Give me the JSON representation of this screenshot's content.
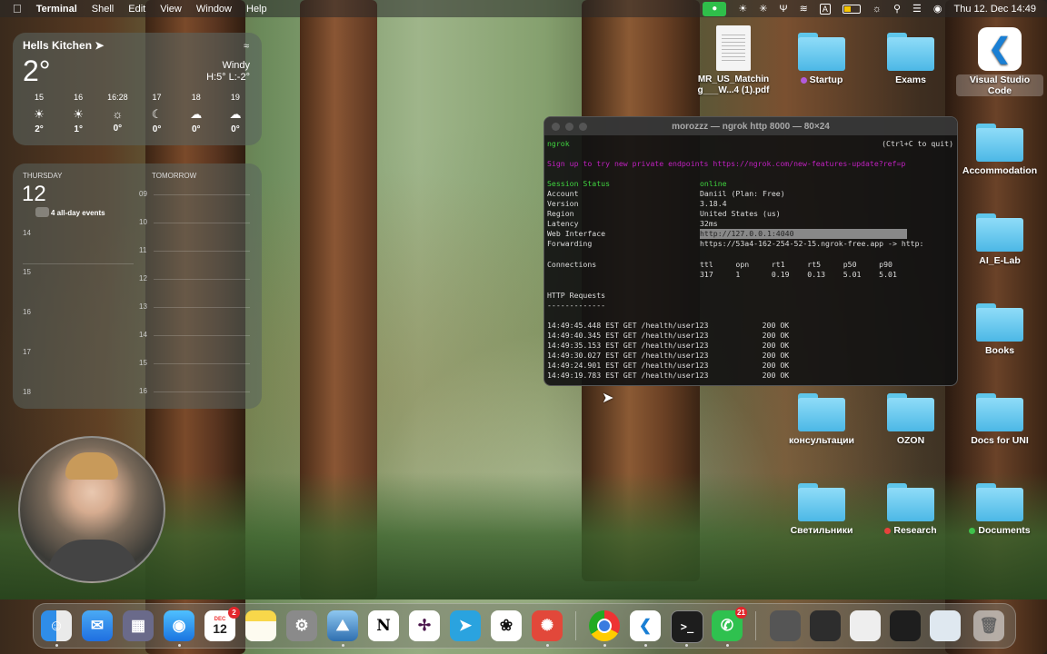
{
  "menubar": {
    "apple_icon": "apple-logo",
    "app_name": "Terminal",
    "menus": [
      "Shell",
      "Edit",
      "View",
      "Window",
      "Help"
    ],
    "input_source": "A",
    "datetime": "Thu 12. Dec  14:49"
  },
  "weather": {
    "city": "Hells Kitchen",
    "temp": "2°",
    "condition": "Windy",
    "hilo": "H:5° L:-2°",
    "forecast": [
      {
        "time": "15",
        "icon": "sun-icon",
        "temp": "2°"
      },
      {
        "time": "16",
        "icon": "sun-icon",
        "temp": "1°"
      },
      {
        "time": "16:28",
        "icon": "sunset-icon",
        "temp": "0°"
      },
      {
        "time": "17",
        "icon": "moon-icon",
        "temp": "0°"
      },
      {
        "time": "18",
        "icon": "cloud-icon",
        "temp": "0°"
      },
      {
        "time": "19",
        "icon": "cloud-icon",
        "temp": "0°"
      }
    ]
  },
  "calendar": {
    "weekday": "THURSDAY",
    "day": "12",
    "tomorrow": "TOMORROW",
    "all_day": "4 all-day events",
    "left_hours": [
      "14",
      "15",
      "16",
      "17",
      "18"
    ],
    "right_hours": [
      "09",
      "10",
      "11",
      "12",
      "13",
      "14",
      "15",
      "16"
    ]
  },
  "terminal": {
    "title": "morozzz — ngrok http 8000 — 80×24",
    "app": "ngrok",
    "quit_hint": "(Ctrl+C to quit)",
    "promo": "Sign up to try new private endpoints https://ngrok.com/new-features-update?ref=p",
    "session_label": "Session Status",
    "session_value": "online",
    "account_label": "Account",
    "account_value": "Daniil (Plan: Free)",
    "version_label": "Version",
    "version_value": "3.18.4",
    "region_label": "Region",
    "region_value": "United States (us)",
    "latency_label": "Latency",
    "latency_value": "32ms",
    "web_label": "Web Interface",
    "web_value": "http://127.0.0.1:4040",
    "fwd_label": "Forwarding",
    "fwd_value": "https://53a4-162-254-52-15.ngrok-free.app -> http:",
    "conn_label": "Connections",
    "conn_headers": "ttl     opn     rt1     rt5     p50     p90",
    "conn_values": "317     1       0.19    0.13    5.01    5.01",
    "http_label": "HTTP Requests",
    "http_underline": "-------------",
    "requests": [
      "14:49:45.448 EST GET /health/user123            200 OK",
      "14:49:40.345 EST GET /health/user123            200 OK",
      "14:49:35.153 EST GET /health/user123            200 OK",
      "14:49:30.027 EST GET /health/user123            200 OK",
      "14:49:24.901 EST GET /health/user123            200 OK",
      "14:49:19.783 EST GET /health/user123            200 OK"
    ]
  },
  "desktop": {
    "pdf": "MR_US_Matchin g___W...4 (1).pdf",
    "startup": "Startup",
    "exams": "Exams",
    "vscode": "Visual Studio Code",
    "accommodation": "Accommodation",
    "ai_lab": "AI_E-Lab",
    "books": "Books",
    "konsult": "консультации",
    "ozon": "OZON",
    "docs_uni": "Docs for UNI",
    "svetilniki": "Светильники",
    "research": "Research",
    "documents": "Documents",
    "tag_colors": {
      "purple": "#b35bdb",
      "red": "#e8423c",
      "green": "#3fc24c"
    }
  },
  "dock": {
    "calendar_month": "DEC",
    "calendar_day": "12",
    "calendar_badge": "2",
    "whatsapp_badge": "21"
  }
}
